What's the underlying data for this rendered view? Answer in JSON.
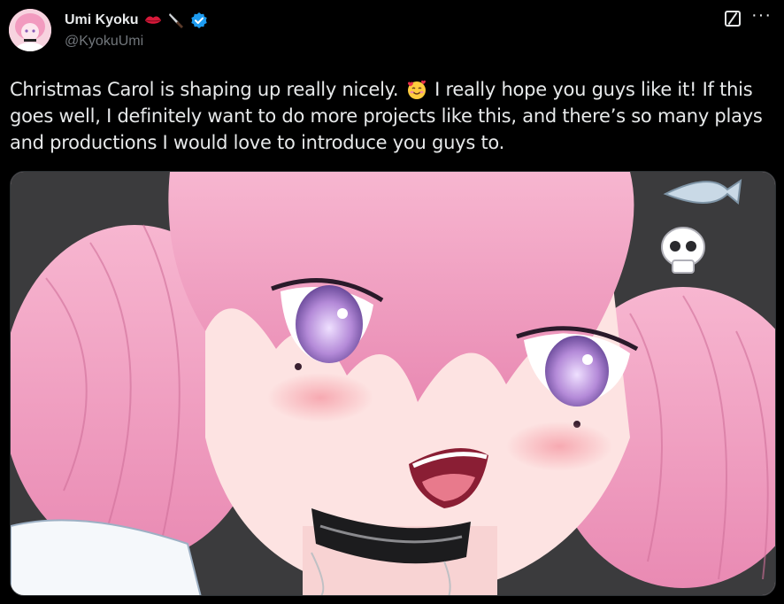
{
  "author": {
    "display_name": "Umi Kyoku",
    "handle": "@KyokuUmi",
    "name_emojis": [
      "lips-emoji",
      "knife-emoji"
    ],
    "verified": true,
    "verified_color": "#1d9bf0"
  },
  "actions": {
    "grok_icon": "grok-icon",
    "more_icon": "more-icon",
    "more_glyph": "···"
  },
  "post": {
    "text_before_emoji": "Christmas Carol is shaping up really nicely. ",
    "emoji": "smiling-face-with-hearts",
    "text_after_emoji": " I really hope you guys like it! If this goes well, I definitely want to do more projects like this, and there’s so many plays and productions I would love to introduce you guys to."
  },
  "media": {
    "type": "image",
    "subject": "anime-girl-illustration",
    "colors": {
      "hair": "#f29bbf",
      "skin": "#fde3e2",
      "eyes": "#b48ad8",
      "background": "#3a3a3a"
    }
  },
  "theme": {
    "background": "#000000",
    "text": "#e7e9ea",
    "muted": "#71767b"
  }
}
